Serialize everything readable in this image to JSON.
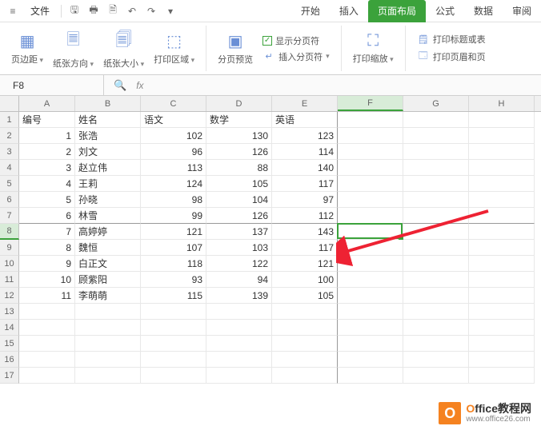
{
  "menubar": {
    "file_label": "文件",
    "tabs": [
      "开始",
      "插入",
      "页面布局",
      "公式",
      "数据",
      "审阅"
    ],
    "active_tab": 2
  },
  "ribbon": {
    "margins": "页边距",
    "orientation": "纸张方向",
    "size": "纸张大小",
    "print_area": "打印区域",
    "page_break_preview": "分页预览",
    "show_page_breaks": "显示分页符",
    "insert_page_break": "插入分页符",
    "print_scaling": "打印缩放",
    "print_titles": "打印标题或表",
    "header_footer": "打印页眉和页"
  },
  "formula": {
    "name_box": "F8",
    "fx_label": "fx"
  },
  "columns": [
    "A",
    "B",
    "C",
    "D",
    "E",
    "F",
    "G",
    "H"
  ],
  "headers": {
    "id": "编号",
    "name": "姓名",
    "chinese": "语文",
    "math": "数学",
    "english": "英语"
  },
  "rows": [
    {
      "id": 1,
      "name": "张浩",
      "chinese": 102,
      "math": 130,
      "english": 123
    },
    {
      "id": 2,
      "name": "刘文",
      "chinese": 96,
      "math": 126,
      "english": 114
    },
    {
      "id": 3,
      "name": "赵立伟",
      "chinese": 113,
      "math": 88,
      "english": 140
    },
    {
      "id": 4,
      "name": "王莉",
      "chinese": 124,
      "math": 105,
      "english": 117
    },
    {
      "id": 5,
      "name": "孙晓",
      "chinese": 98,
      "math": 104,
      "english": 97
    },
    {
      "id": 6,
      "name": "林雪",
      "chinese": 99,
      "math": 126,
      "english": 112
    },
    {
      "id": 7,
      "name": "高婷婷",
      "chinese": 121,
      "math": 137,
      "english": 143
    },
    {
      "id": 8,
      "name": "魏恒",
      "chinese": 107,
      "math": 103,
      "english": 117
    },
    {
      "id": 9,
      "name": "白正文",
      "chinese": 118,
      "math": 122,
      "english": 121
    },
    {
      "id": 10,
      "name": "顾紫阳",
      "chinese": 93,
      "math": 94,
      "english": 100
    },
    {
      "id": 11,
      "name": "李萌萌",
      "chinese": 115,
      "math": 139,
      "english": 105
    }
  ],
  "selection": {
    "cell": "F8",
    "row_index": 8,
    "col_index": 5
  },
  "watermark": {
    "brand_o": "O",
    "brand_rest": "ffice教程网",
    "url": "www.office26.com"
  }
}
